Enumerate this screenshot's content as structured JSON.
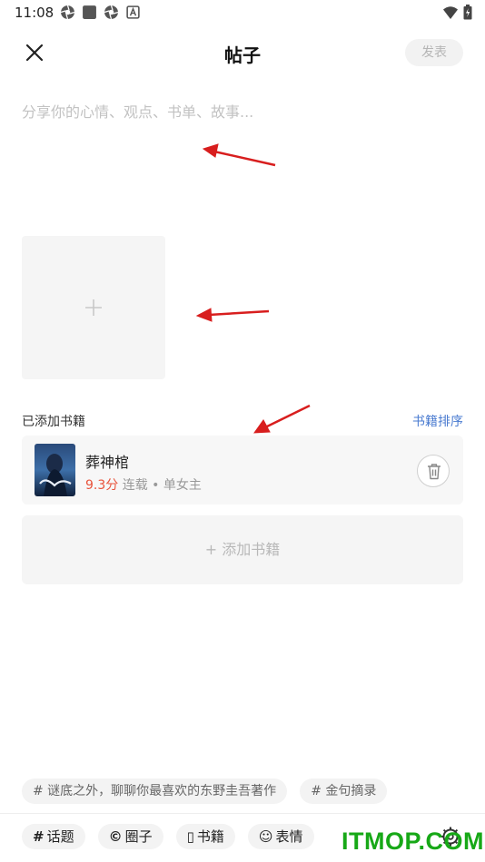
{
  "status_bar": {
    "time": "11:08"
  },
  "header": {
    "title": "帖子",
    "publish_label": "发表"
  },
  "editor": {
    "placeholder": "分享你的心情、观点、书单、故事..."
  },
  "books_section": {
    "label": "已添加书籍",
    "sort_label": "书籍排序",
    "books": [
      {
        "title": "葬神棺",
        "score": "9.3分",
        "meta": "连载 • 单女主"
      }
    ],
    "add_label": "+ 添加书籍"
  },
  "topic_chips": [
    "# 谜底之外，聊聊你最喜欢的东野圭吾著作",
    "# 金句摘录"
  ],
  "toolbar": {
    "items": [
      {
        "icon": "#",
        "label": "话题"
      },
      {
        "icon": "©",
        "label": "圈子"
      },
      {
        "icon": "▯",
        "label": "书籍"
      },
      {
        "icon": "☺",
        "label": "表情"
      }
    ]
  },
  "watermark": "ITMOP.COM",
  "colors": {
    "accent_link": "#4a7bd0",
    "score": "#e8533b",
    "watermark": "#17a817",
    "arrow": "#d81e1e"
  }
}
